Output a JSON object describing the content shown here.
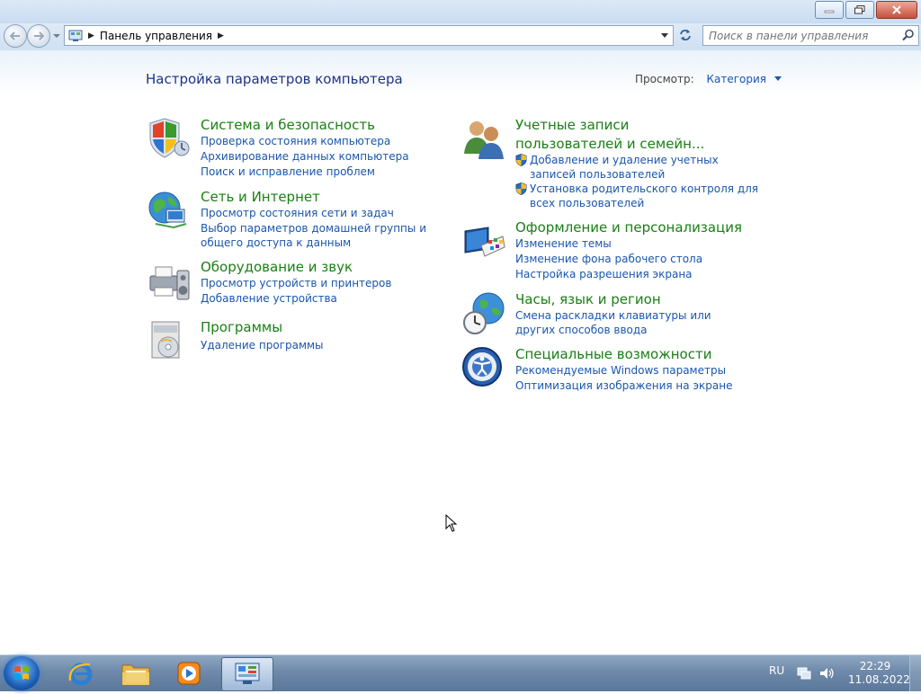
{
  "window": {
    "address_crumbs": [
      "Панель управления"
    ],
    "search_placeholder": "Поиск в панели управления"
  },
  "page": {
    "heading": "Настройка параметров компьютера",
    "view_label": "Просмотр:",
    "view_value": "Категория"
  },
  "left_categories": [
    {
      "icon": "shield-icon",
      "title": "Система и безопасность",
      "links": [
        "Проверка состояния компьютера",
        "Архивирование данных компьютера",
        "Поиск и исправление проблем"
      ]
    },
    {
      "icon": "network-globe-icon",
      "title": "Сеть и Интернет",
      "links": [
        "Просмотр состояния сети и задач",
        "Выбор параметров домашней группы и общего доступа к данным"
      ]
    },
    {
      "icon": "printer-speaker-icon",
      "title": "Оборудование и звук",
      "links": [
        "Просмотр устройств и принтеров",
        "Добавление устройства"
      ]
    },
    {
      "icon": "programs-disc-icon",
      "title": "Программы",
      "links": [
        "Удаление программы"
      ]
    }
  ],
  "right_categories": [
    {
      "icon": "users-icon",
      "title": "Учетные записи пользователей и семейн...",
      "links": [
        "Добавление и удаление учетных записей пользователей",
        "Установка родительского контроля для всех пользователей"
      ]
    },
    {
      "icon": "monitor-palette-icon",
      "title": "Оформление и персонализация",
      "links": [
        "Изменение темы",
        "Изменение фона рабочего стола",
        "Настройка разрешения экрана"
      ]
    },
    {
      "icon": "clock-globe-icon",
      "title": "Часы, язык и регион",
      "links": [
        "Смена раскладки клавиатуры или других способов ввода"
      ]
    },
    {
      "icon": "accessibility-icon",
      "title": "Специальные возможности",
      "links": [
        "Рекомендуемые Windows параметры",
        "Оптимизация изображения на экране"
      ]
    }
  ],
  "taskbar": {
    "apps": [
      "internet-explorer-icon",
      "file-explorer-icon",
      "media-player-icon",
      "control-panel-icon"
    ],
    "language": "RU",
    "time": "22:29",
    "date": "11.08.2022"
  }
}
